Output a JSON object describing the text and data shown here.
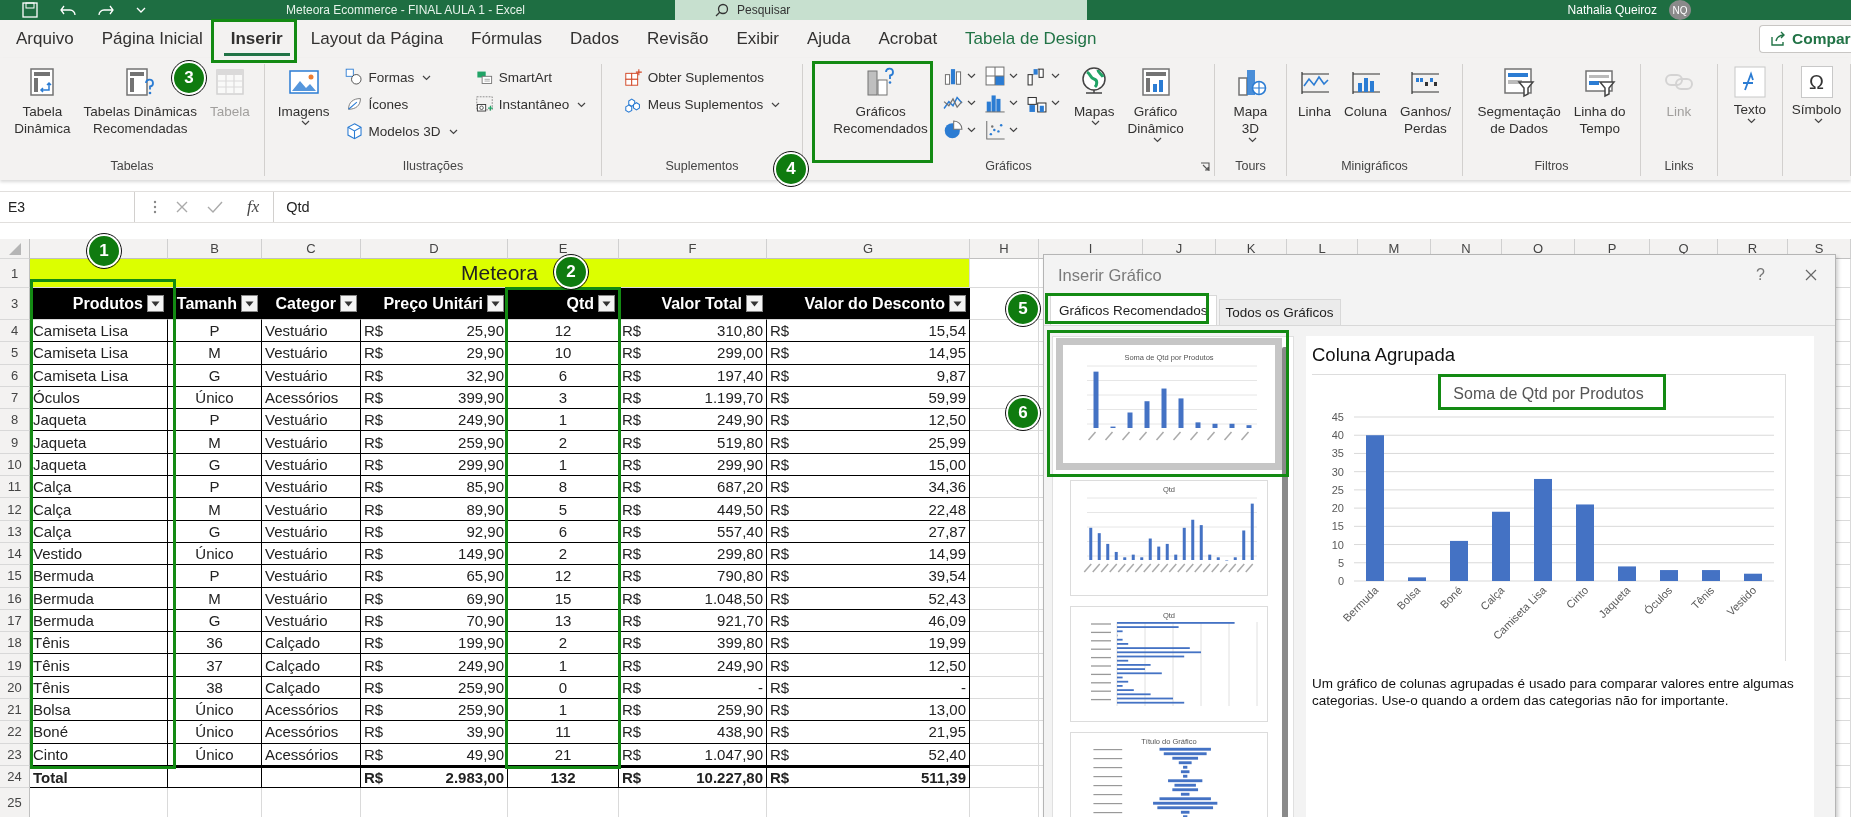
{
  "title_bar": {
    "title": "Meteora Ecommerce - FINAL AULA 1 - Excel",
    "search_placeholder": "Pesquisar",
    "user": "Nathalia Queiroz",
    "avatar": "NQ"
  },
  "tabs": [
    {
      "label": "Arquivo",
      "selected": false,
      "kind": "tab"
    },
    {
      "label": "Página Inicial",
      "selected": false,
      "kind": "tab"
    },
    {
      "label": "Inserir",
      "selected": true,
      "kind": "tab"
    },
    {
      "label": "Layout da Página",
      "selected": false,
      "kind": "tab"
    },
    {
      "label": "Fórmulas",
      "selected": false,
      "kind": "tab"
    },
    {
      "label": "Dados",
      "selected": false,
      "kind": "tab"
    },
    {
      "label": "Revisão",
      "selected": false,
      "kind": "tab"
    },
    {
      "label": "Exibir",
      "selected": false,
      "kind": "tab"
    },
    {
      "label": "Ajuda",
      "selected": false,
      "kind": "tab"
    },
    {
      "label": "Acrobat",
      "selected": false,
      "kind": "tab"
    },
    {
      "label": "Tabela de Design",
      "selected": false,
      "kind": "context"
    }
  ],
  "share_button": "Compar",
  "ribbon": {
    "groups": [
      {
        "label": "Tabelas",
        "items": [
          {
            "kind": "large",
            "label": "Tabela\nDinâmica",
            "disabled": false,
            "dropdown": false
          },
          {
            "kind": "large",
            "label": "Tabelas Dinâmicas\nRecomendadas",
            "disabled": false,
            "dropdown": false
          },
          {
            "kind": "large",
            "label": "Tabela",
            "disabled": true,
            "dropdown": false
          }
        ]
      },
      {
        "label": "Ilustrações",
        "items": [
          {
            "kind": "large",
            "label": "Imagens",
            "disabled": false,
            "dropdown": true
          },
          {
            "kind": "stack",
            "items": [
              {
                "label": "Formas",
                "disabled": false,
                "dropdown": true
              },
              {
                "label": "Ícones",
                "disabled": false,
                "dropdown": false
              },
              {
                "label": "Modelos 3D",
                "disabled": false,
                "dropdown": true
              }
            ]
          },
          {
            "kind": "stack",
            "items": [
              {
                "label": "SmartArt",
                "disabled": false,
                "dropdown": false
              },
              {
                "label": "Instantâneo",
                "disabled": false,
                "dropdown": true
              }
            ]
          }
        ]
      },
      {
        "label": "Suplementos",
        "items": [
          {
            "kind": "stack",
            "items": [
              {
                "label": "Obter Suplementos",
                "disabled": false,
                "dropdown": false
              },
              {
                "label": "Meus Suplementos",
                "disabled": false,
                "dropdown": true
              }
            ]
          }
        ]
      },
      {
        "label": "Gráficos",
        "launcher": true,
        "items": [
          {
            "kind": "large",
            "label": "Gráficos\nRecomendados",
            "disabled": false,
            "dropdown": false
          },
          {
            "kind": "chart-types"
          },
          {
            "kind": "large",
            "label": "Mapas",
            "disabled": false,
            "dropdown": true
          },
          {
            "kind": "large",
            "label": "Gráfico\nDinâmico",
            "disabled": false,
            "dropdown": true
          }
        ]
      },
      {
        "label": "Tours",
        "items": [
          {
            "kind": "large",
            "label": "Mapa\n3D",
            "disabled": false,
            "dropdown": true
          }
        ]
      },
      {
        "label": "Minigráficos",
        "items": [
          {
            "kind": "large",
            "label": "Linha",
            "disabled": false,
            "dropdown": false
          },
          {
            "kind": "large",
            "label": "Coluna",
            "disabled": false,
            "dropdown": false
          },
          {
            "kind": "large",
            "label": "Ganhos/\nPerdas",
            "disabled": false,
            "dropdown": false
          }
        ]
      },
      {
        "label": "Filtros",
        "items": [
          {
            "kind": "large",
            "label": "Segmentação\nde Dados",
            "disabled": false,
            "dropdown": false
          },
          {
            "kind": "large",
            "label": "Linha do\nTempo",
            "disabled": false,
            "dropdown": false
          }
        ]
      },
      {
        "label": "Links",
        "items": [
          {
            "kind": "large",
            "label": "Link",
            "disabled": true,
            "dropdown": false
          }
        ]
      },
      {
        "items": [
          {
            "kind": "boxed",
            "label": "Texto",
            "disabled": false,
            "dropdown": true
          }
        ]
      },
      {
        "items": [
          {
            "kind": "boxed",
            "label": "Símbolo",
            "glyph": "Ω",
            "disabled": false,
            "dropdown": true
          }
        ]
      }
    ]
  },
  "formula_bar": {
    "name_box": "E3",
    "function_label": "fx",
    "content": "Qtd"
  },
  "sheet": {
    "column_headers": [
      "B",
      "C",
      "D",
      "E",
      "F",
      "G",
      "H",
      "I",
      "J",
      "K",
      "L",
      "M",
      "N",
      "O",
      "P",
      "Q",
      "R",
      "S"
    ],
    "row_headers": [
      "1",
      "3",
      "4",
      "5",
      "6",
      "7",
      "8",
      "9",
      "10",
      "11",
      "12",
      "13",
      "14",
      "15",
      "16",
      "17",
      "18",
      "19",
      "20",
      "21",
      "22",
      "23",
      "24",
      "25"
    ],
    "title": "Meteora",
    "headers": [
      "Produtos",
      "Tamanh",
      "Categor",
      "Preço Unitári",
      "Qtd",
      "Valor Total",
      "Valor do Desconto"
    ],
    "rows": [
      [
        "Camiseta Lisa",
        "P",
        "Vestuário",
        "R$",
        "25,90",
        "12",
        "R$",
        "310,80",
        "R$",
        "15,54"
      ],
      [
        "Camiseta Lisa",
        "M",
        "Vestuário",
        "R$",
        "29,90",
        "10",
        "R$",
        "299,00",
        "R$",
        "14,95"
      ],
      [
        "Camiseta Lisa",
        "G",
        "Vestuário",
        "R$",
        "32,90",
        "6",
        "R$",
        "197,40",
        "R$",
        "9,87"
      ],
      [
        "Óculos",
        "Único",
        "Acessórios",
        "R$",
        "399,90",
        "3",
        "R$",
        "1.199,70",
        "R$",
        "59,99"
      ],
      [
        "Jaqueta",
        "P",
        "Vestuário",
        "R$",
        "249,90",
        "1",
        "R$",
        "249,90",
        "R$",
        "12,50"
      ],
      [
        "Jaqueta",
        "M",
        "Vestuário",
        "R$",
        "259,90",
        "2",
        "R$",
        "519,80",
        "R$",
        "25,99"
      ],
      [
        "Jaqueta",
        "G",
        "Vestuário",
        "R$",
        "299,90",
        "1",
        "R$",
        "299,90",
        "R$",
        "15,00"
      ],
      [
        "Calça",
        "P",
        "Vestuário",
        "R$",
        "85,90",
        "8",
        "R$",
        "687,20",
        "R$",
        "34,36"
      ],
      [
        "Calça",
        "M",
        "Vestuário",
        "R$",
        "89,90",
        "5",
        "R$",
        "449,50",
        "R$",
        "22,48"
      ],
      [
        "Calça",
        "G",
        "Vestuário",
        "R$",
        "92,90",
        "6",
        "R$",
        "557,40",
        "R$",
        "27,87"
      ],
      [
        "Vestido",
        "Único",
        "Vestuário",
        "R$",
        "149,90",
        "2",
        "R$",
        "299,80",
        "R$",
        "14,99"
      ],
      [
        "Bermuda",
        "P",
        "Vestuário",
        "R$",
        "65,90",
        "12",
        "R$",
        "790,80",
        "R$",
        "39,54"
      ],
      [
        "Bermuda",
        "M",
        "Vestuário",
        "R$",
        "69,90",
        "15",
        "R$",
        "1.048,50",
        "R$",
        "52,43"
      ],
      [
        "Bermuda",
        "G",
        "Vestuário",
        "R$",
        "70,90",
        "13",
        "R$",
        "921,70",
        "R$",
        "46,09"
      ],
      [
        "Tênis",
        "36",
        "Calçado",
        "R$",
        "199,90",
        "2",
        "R$",
        "399,80",
        "R$",
        "19,99"
      ],
      [
        "Tênis",
        "37",
        "Calçado",
        "R$",
        "249,90",
        "1",
        "R$",
        "249,90",
        "R$",
        "12,50"
      ],
      [
        "Tênis",
        "38",
        "Calçado",
        "R$",
        "259,90",
        "0",
        "R$",
        "-",
        "R$",
        "-"
      ],
      [
        "Bolsa",
        "Único",
        "Acessórios",
        "R$",
        "259,90",
        "1",
        "R$",
        "259,90",
        "R$",
        "13,00"
      ],
      [
        "Boné",
        "Único",
        "Acessórios",
        "R$",
        "39,90",
        "11",
        "R$",
        "438,90",
        "R$",
        "21,95"
      ],
      [
        "Cinto",
        "Único",
        "Acessórios",
        "R$",
        "49,90",
        "21",
        "R$",
        "1.047,90",
        "R$",
        "52,40"
      ]
    ],
    "total": {
      "label": "Total",
      "price": [
        "R$",
        "2.983,00"
      ],
      "qty": "132",
      "total": [
        "R$",
        "10.227,80"
      ],
      "discount": [
        "R$",
        "511,39"
      ]
    }
  },
  "dialog": {
    "title": "Inserir Gráfico",
    "help": "?",
    "tabs": [
      {
        "label": "Gráficos Recomendados",
        "selected": true
      },
      {
        "label": "Todos os Gráficos",
        "selected": false
      }
    ],
    "thumbnails": [
      {
        "title": "Soma de Qtd por Produtos",
        "kind": "column-summary",
        "selected": true
      },
      {
        "title": "Qtd",
        "kind": "column",
        "selected": false
      },
      {
        "title": "Qtd",
        "kind": "bar",
        "selected": false
      },
      {
        "title": "Título do Gráfico",
        "kind": "funnel",
        "selected": false
      }
    ],
    "preview": {
      "heading": "Coluna Agrupada",
      "chart_data": {
        "type": "bar",
        "title": "Soma de Qtd por Produtos",
        "categories": [
          "Bermuda",
          "Bolsa",
          "Boné",
          "Calça",
          "Camiseta Lisa",
          "Cinto",
          "Jaqueta",
          "Óculos",
          "Tênis",
          "Vestido"
        ],
        "series": [
          {
            "color": "#4472c4",
            "values": [
              40,
              1,
              11,
              19,
              28,
              21,
              4,
              3,
              3,
              2
            ]
          }
        ],
        "grid": true,
        "ylim": [
          0,
          45
        ],
        "yticks": [
          0,
          5,
          10,
          15,
          20,
          25,
          30,
          35,
          40,
          45
        ]
      },
      "description": "Um gráfico de colunas agrupadas é usado para comparar valores entre algumas categorias. Use-o quando a ordem das categorias não for importante."
    }
  },
  "annotations": [
    "1",
    "2",
    "3",
    "4",
    "5",
    "6"
  ]
}
